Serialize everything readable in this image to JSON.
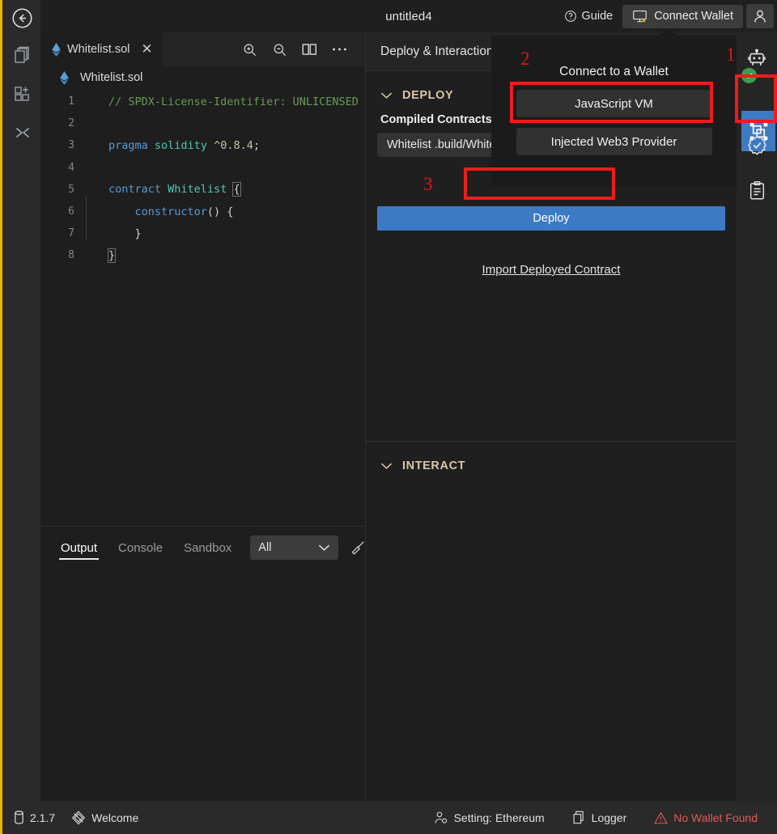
{
  "window": {
    "title": "untitled4",
    "back_icon": "back-arrow-icon"
  },
  "titlebar": {
    "guide_label": "Guide",
    "guide_icon": "question-circle-icon",
    "connect_wallet_label": "Connect Wallet",
    "connect_wallet_icon": "monitor-wallet-icon",
    "account_icon": "person-icon"
  },
  "left_activity_bar": {
    "items": [
      {
        "name": "file-explorer-icon",
        "label": "File Explorer"
      },
      {
        "name": "plugin-manager-icon",
        "label": "Plugin Manager"
      },
      {
        "name": "terminal-icon",
        "label": "Terminal"
      }
    ]
  },
  "editor": {
    "tab": {
      "filename": "Whitelist.sol",
      "file_icon": "ethereum-icon",
      "close_icon": "close-icon"
    },
    "actions": [
      {
        "name": "zoom-in-icon",
        "label": "Zoom In"
      },
      {
        "name": "zoom-out-icon",
        "label": "Zoom Out"
      },
      {
        "name": "split-editor-icon",
        "label": "Split Editor"
      },
      {
        "name": "more-actions-icon",
        "label": "More Actions"
      }
    ],
    "breadcrumb": {
      "file_icon": "ethereum-icon",
      "filename": "Whitelist.sol"
    },
    "lines": [
      {
        "num": "1",
        "tokens": [
          {
            "t": "// SPDX-License-Identifier: UNLICENSED",
            "c": "cm"
          }
        ]
      },
      {
        "num": "2",
        "tokens": []
      },
      {
        "num": "3",
        "tokens": [
          {
            "t": "pragma",
            "c": "kw"
          },
          {
            "t": " ",
            "c": "pl"
          },
          {
            "t": "solidity",
            "c": "ty"
          },
          {
            "t": " ",
            "c": "pl"
          },
          {
            "t": "^0.8.4",
            "c": "nm"
          },
          {
            "t": ";",
            "c": "pl"
          }
        ]
      },
      {
        "num": "4",
        "tokens": []
      },
      {
        "num": "5",
        "tokens": [
          {
            "t": "contract",
            "c": "kw"
          },
          {
            "t": " ",
            "c": "pl"
          },
          {
            "t": "Whitelist",
            "c": "ty"
          },
          {
            "t": " ",
            "c": "pl"
          },
          {
            "t": "{",
            "c": "pl"
          }
        ]
      },
      {
        "num": "6",
        "tokens": [
          {
            "t": "    ",
            "c": "pl"
          },
          {
            "t": "constructor",
            "c": "kw"
          },
          {
            "t": "() {",
            "c": "pl"
          }
        ]
      },
      {
        "num": "7",
        "tokens": [
          {
            "t": "    }",
            "c": "pl"
          }
        ]
      },
      {
        "num": "8",
        "tokens": [
          {
            "t": "}",
            "c": "pl"
          }
        ]
      }
    ]
  },
  "output_panel": {
    "tabs": [
      {
        "label": "Output",
        "active": true
      },
      {
        "label": "Console",
        "active": false
      },
      {
        "label": "Sandbox",
        "active": false
      }
    ],
    "filter_value": "All",
    "filter_chevron": "chevron-down-icon",
    "clear_icon": "clear-broom-icon"
  },
  "right_panel": {
    "header": "Deploy & Interaction",
    "deploy_section": {
      "title": "DEPLOY",
      "chevron": "chevron-down-icon",
      "compiled_contracts_label": "Compiled Contracts",
      "contract_value": "Whitelist .build/Whitelist.sol",
      "deploy_button": "Deploy",
      "import_link": "Import Deployed Contract"
    },
    "interact_section": {
      "title": "INTERACT",
      "chevron": "chevron-down-icon"
    }
  },
  "right_activity_bar": {
    "items": [
      {
        "name": "ai-robot-icon",
        "label": "AI Assistant",
        "badge": "check",
        "active": false
      },
      {
        "name": "deploy-run-icon",
        "label": "Deploy & Interaction",
        "active": true
      },
      {
        "name": "verify-contract-icon",
        "label": "Verify Contract",
        "active": false
      },
      {
        "name": "clipboard-icon",
        "label": "Clipboard",
        "active": false
      }
    ]
  },
  "wallet_modal": {
    "title": "Connect to a Wallet",
    "options": [
      {
        "label": "JavaScript VM"
      },
      {
        "label": "Injected Web3 Provider"
      }
    ]
  },
  "annotations": [
    {
      "num": "1"
    },
    {
      "num": "2"
    },
    {
      "num": "3"
    }
  ],
  "statusbar": {
    "version_icon": "database-icon",
    "version": "2.1.7",
    "welcome_icon": "remix-logo-icon",
    "welcome": "Welcome",
    "setting_icon": "person-gear-icon",
    "setting": "Setting: Ethereum",
    "logger_icon": "copy-icon",
    "logger": "Logger",
    "wallet_warn_icon": "warning-triangle-icon",
    "wallet_warn": "No Wallet Found"
  },
  "colors": {
    "accent_blue": "#3d7ac4",
    "annotation_red": "#ee1c1c",
    "sidebar_yellow": "#e8b30b",
    "green_badge": "#3a9e4e",
    "warn_red": "#e05a5a"
  }
}
